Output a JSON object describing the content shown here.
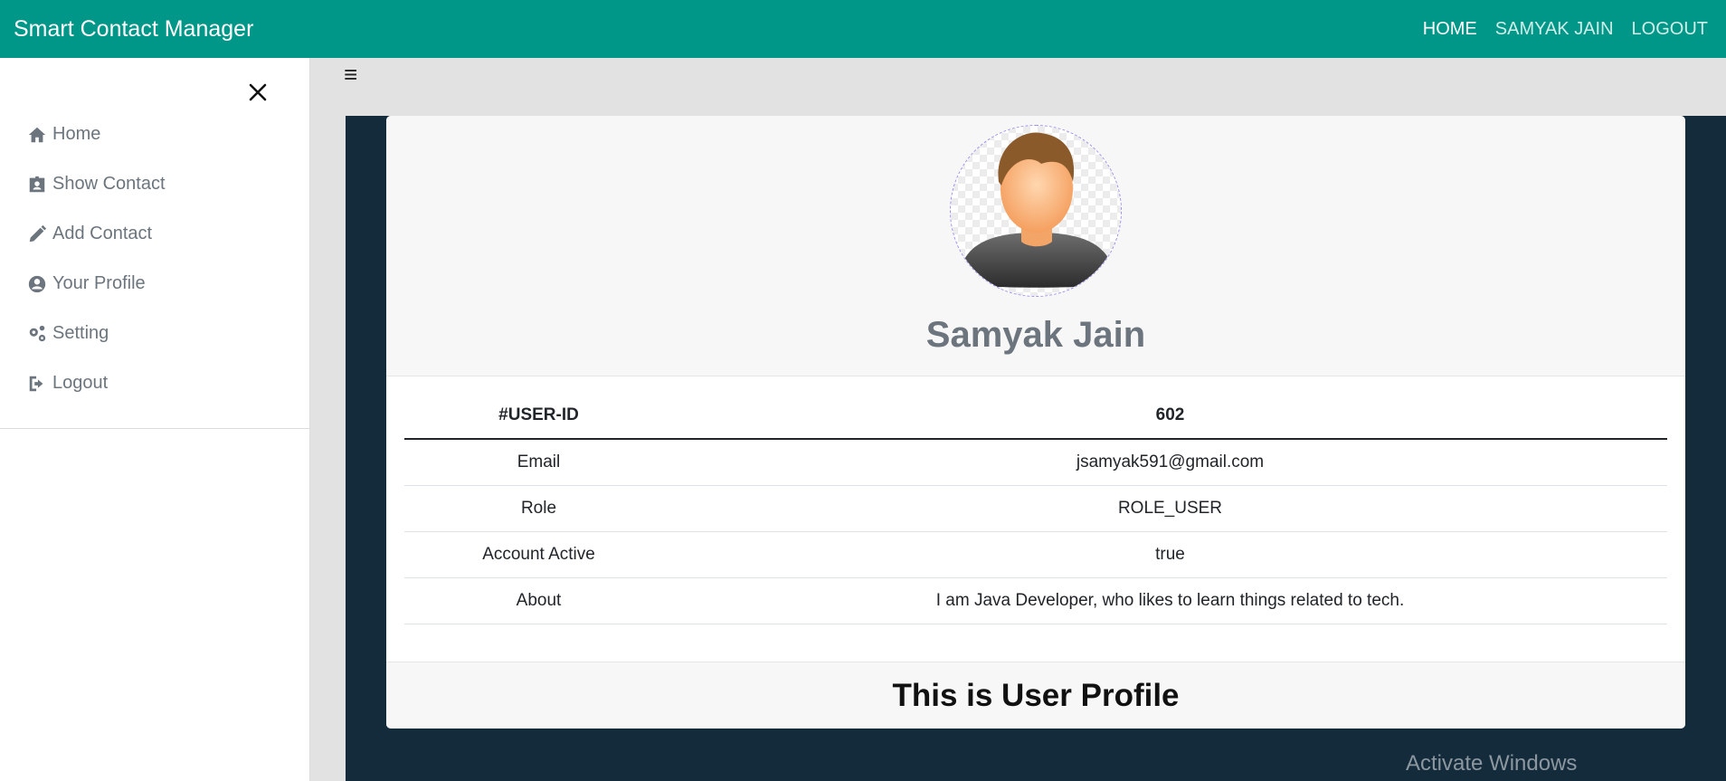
{
  "navbar": {
    "brand": "Smart Contact Manager",
    "links": [
      {
        "label": "HOME"
      },
      {
        "label": "SAMYAK JAIN"
      },
      {
        "label": "LOGOUT"
      }
    ]
  },
  "sidebar": {
    "items": [
      {
        "label": "Home",
        "icon": "home-icon"
      },
      {
        "label": "Show Contact",
        "icon": "contact-card-icon"
      },
      {
        "label": "Add Contact",
        "icon": "pencil-icon"
      },
      {
        "label": "Your Profile",
        "icon": "user-circle-icon"
      },
      {
        "label": "Setting",
        "icon": "gears-icon"
      },
      {
        "label": "Logout",
        "icon": "sign-out-icon"
      }
    ]
  },
  "profile": {
    "name": "Samyak Jain",
    "table": {
      "header": {
        "key": "#USER-ID",
        "value": "602"
      },
      "rows": [
        {
          "key": "Email",
          "value": "jsamyak591@gmail.com"
        },
        {
          "key": "Role",
          "value": "ROLE_USER"
        },
        {
          "key": "Account Active",
          "value": "true"
        },
        {
          "key": "About",
          "value": "I am Java Developer, who likes to learn things related to tech."
        }
      ]
    },
    "footer": "This is User Profile"
  },
  "watermark": "Activate Windows",
  "colors": {
    "navbar": "#009688",
    "content_bg": "#142b3b"
  }
}
